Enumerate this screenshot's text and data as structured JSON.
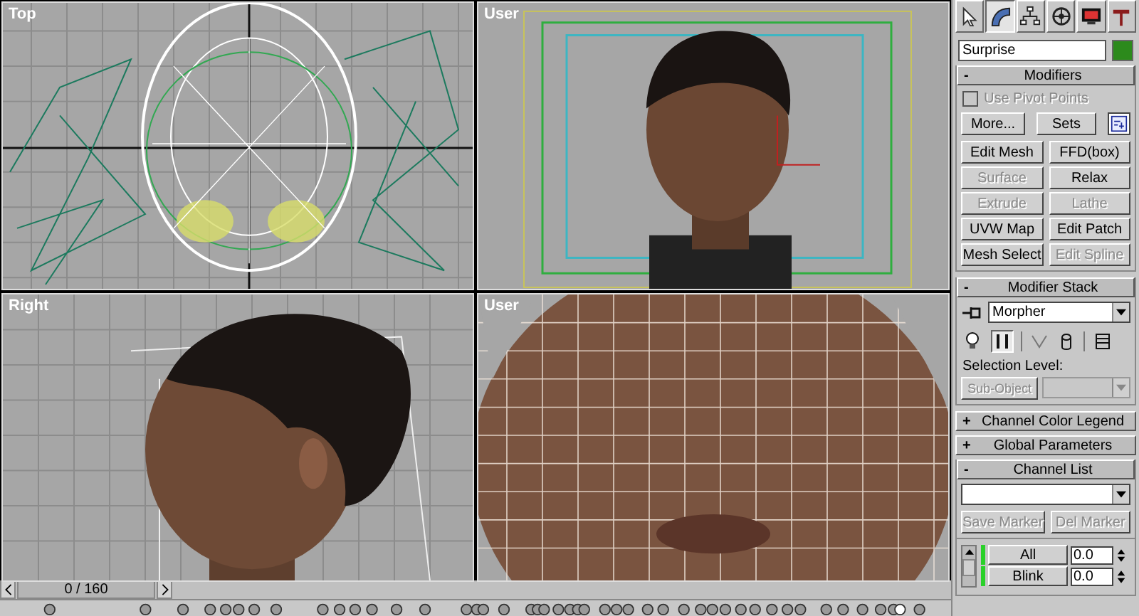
{
  "viewports": [
    {
      "label": "Top",
      "kind": "top"
    },
    {
      "label": "User",
      "kind": "user-camera"
    },
    {
      "label": "Right",
      "kind": "right"
    },
    {
      "label": "User",
      "kind": "user-mesh"
    }
  ],
  "time_slider": {
    "readout": "0 / 160",
    "level": 0
  },
  "command_panel": {
    "tabs": [
      {
        "kind": "create",
        "selected": false
      },
      {
        "kind": "modify",
        "selected": true
      },
      {
        "kind": "hierarchy",
        "selected": false
      },
      {
        "kind": "motion",
        "selected": false
      },
      {
        "kind": "display",
        "selected": false
      },
      {
        "kind": "utilities",
        "selected": false
      }
    ],
    "object_name": "Surprise",
    "modifiers": {
      "sign": "-",
      "title": "Modifiers",
      "use_pivot_points": {
        "label": "Use Pivot Points",
        "checked": false,
        "disabled": true
      },
      "more": "More...",
      "sets": "Sets",
      "buttons": [
        {
          "label": "Edit Mesh",
          "disabled": false
        },
        {
          "label": "FFD(box)",
          "disabled": false
        },
        {
          "label": "Surface",
          "disabled": true
        },
        {
          "label": "Relax",
          "disabled": false
        },
        {
          "label": "Extrude",
          "disabled": true
        },
        {
          "label": "Lathe",
          "disabled": true
        },
        {
          "label": "UVW Map",
          "disabled": false
        },
        {
          "label": "Edit Patch",
          "disabled": false
        },
        {
          "label": "Mesh Select",
          "disabled": false
        },
        {
          "label": "Edit Spline",
          "disabled": true
        }
      ]
    },
    "modifier_stack": {
      "sign": "-",
      "title": "Modifier Stack",
      "current": "Morpher",
      "selection_level_label": "Selection Level:",
      "sub_object": {
        "label": "Sub-Object",
        "disabled": true
      }
    },
    "rollouts": [
      {
        "sign": "+",
        "title": "Channel Color Legend"
      },
      {
        "sign": "+",
        "title": "Global Parameters"
      }
    ],
    "channel_list": {
      "sign": "-",
      "title": "Channel List",
      "save_marker": {
        "label": "Save Marker",
        "disabled": true
      },
      "del_marker": {
        "label": "Del Marker",
        "disabled": true
      },
      "channels": [
        {
          "name": "All",
          "value": "0.0"
        },
        {
          "name": "Blink",
          "value": "0.0"
        }
      ]
    }
  }
}
